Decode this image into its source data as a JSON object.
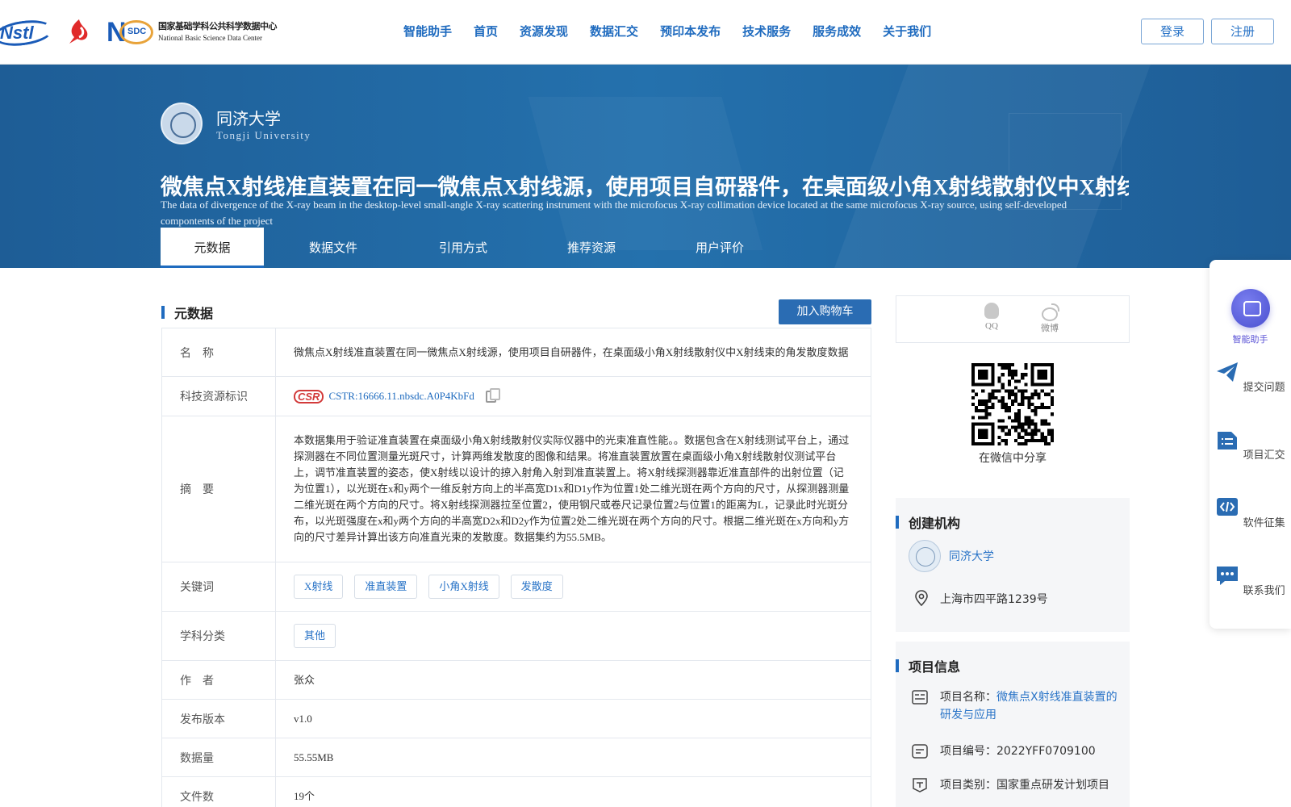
{
  "header": {
    "logos": {
      "nstl": "Nstl",
      "nsdc_mark": "SDC",
      "nsdc_cn": "国家基础学科公共科学数据中心",
      "nsdc_en": "National Basic Science Data Center"
    },
    "nav": [
      "智能助手",
      "首页",
      "资源发现",
      "数据汇交",
      "预印本发布",
      "技术服务",
      "服务成效",
      "关于我们"
    ],
    "login_label": "登录",
    "register_label": "注册"
  },
  "banner": {
    "institution_cn": "同济大学",
    "institution_en": "Tongji University",
    "title_cn": "微焦点X射线准直装置在同一微焦点X射线源，使用项目自研器件，在桌面级小角X射线散射仪中X射线束",
    "title_en": "The data of divergence of the X-ray beam in the desktop-level small-angle X-ray scattering instrument with the microfocus X-ray collimation device located at the same microfocus X-ray source, using self-developed compontents of the project",
    "tabs": [
      "元数据",
      "数据文件",
      "引用方式",
      "推荐资源",
      "用户评价"
    ],
    "active_tab": "元数据"
  },
  "metadata": {
    "section_title": "元数据",
    "cart_label": "加入购物车",
    "name_label": "名　称",
    "name": "微焦点X射线准直装置在同一微焦点X射线源，使用项目自研器件，在桌面级小角X射线散射仪中X射线束的角发散度数据",
    "id_label": "科技资源标识",
    "csr_logo": "CSR",
    "cstr": "CSTR:16666.11.nbsdc.A0P4KbFd",
    "abstract_label": "摘　要",
    "abstract": "本数据集用于验证准直装置在桌面级小角X射线散射仪实际仪器中的光束准直性能。。数据包含在X射线测试平台上，通过探测器在不同位置测量光斑尺寸，计算两维发散度的图像和结果。将准直装置放置在桌面级小角X射线散射仪测试平台上，调节准直装置的姿态，使X射线以设计的掠入射角入射到准直装置上。将X射线探测器靠近准直部件的出射位置（记为位置1），以光斑在x和y两个一维反射方向上的半高宽D1x和D1y作为位置1处二维光斑在两个方向的尺寸，从探测器测量二维光斑在两个方向的尺寸。将X射线探测器拉至位置2，使用钢尺或卷尺记录位置2与位置1的距离为L，记录此时光斑分布，以光斑强度在x和y两个方向的半高宽D2x和D2y作为位置2处二维光斑在两个方向的尺寸。根据二维光斑在x方向和y方向的尺寸差异计算出该方向准直光束的发散度。数据集约为55.5MB。",
    "keywords_label": "关键词",
    "keywords": [
      "X射线",
      "准直装置",
      "小角X射线",
      "发散度"
    ],
    "subject_label": "学科分类",
    "subjects": [
      "其他"
    ],
    "author_label": "作　者",
    "author": "张众",
    "version_label": "发布版本",
    "version": "v1.0",
    "size_label": "数据量",
    "size": "55.55MB",
    "files_label": "文件数",
    "files": "19个"
  },
  "share": {
    "qq_label": "QQ",
    "weibo_label": "微博",
    "qr_caption": "在微信中分享"
  },
  "org": {
    "title": "创建机构",
    "name": "同济大学",
    "address": "上海市四平路1239号"
  },
  "project": {
    "title": "项目信息",
    "name_label": "项目名称：",
    "name": "微焦点X射线准直装置的研发与应用",
    "code_label": "项目编号：",
    "code": "2022YFF0709100",
    "type_label": "项目类别：",
    "type": "国家重点研发计划项目"
  },
  "floatbar": {
    "assistant": "智能助手",
    "submit": "提交问题",
    "project_submit": "项目汇交",
    "software": "软件征集",
    "contact": "联系我们"
  },
  "colors": {
    "primary": "#1f6bbf",
    "banner": "#2471ad",
    "assistant": "#5a52d6"
  }
}
